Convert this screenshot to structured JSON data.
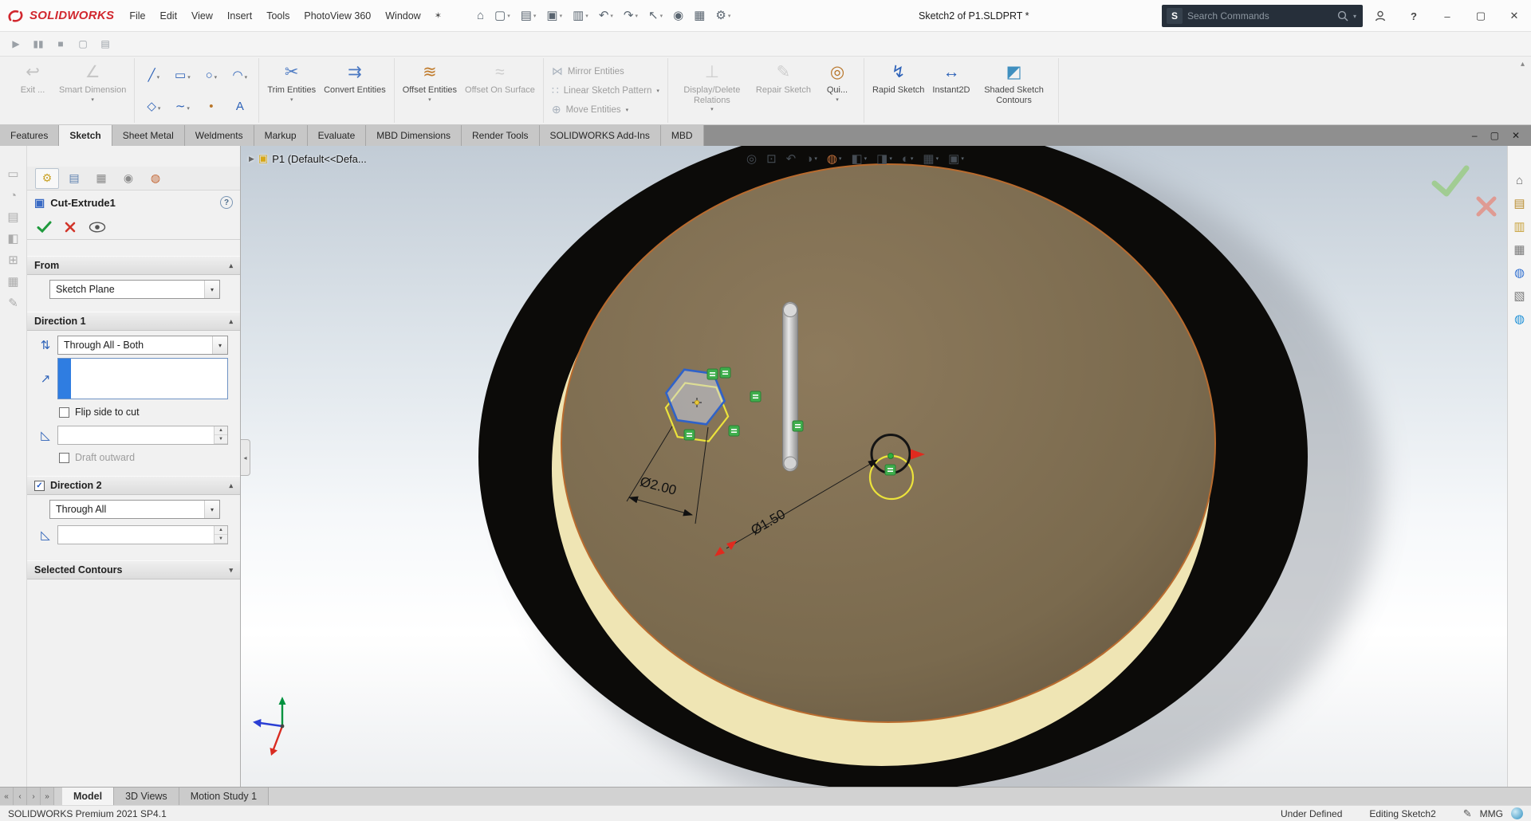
{
  "titlebar": {
    "logo_text": "SOLIDWORKS",
    "menus": [
      "File",
      "Edit",
      "View",
      "Insert",
      "Tools",
      "PhotoView 360",
      "Window"
    ],
    "title": "Sketch2 of P1.SLDPRT *",
    "search_placeholder": "Search Commands",
    "quick_access": [
      {
        "name": "view-home",
        "glyph": "⌂"
      },
      {
        "name": "new-document",
        "glyph": "▢",
        "caret": true
      },
      {
        "name": "open-document",
        "glyph": "▤",
        "caret": true
      },
      {
        "name": "save-document",
        "glyph": "▣",
        "caret": true
      },
      {
        "name": "print-document",
        "glyph": "▥",
        "caret": true
      },
      {
        "name": "undo",
        "glyph": "↶",
        "caret": true
      },
      {
        "name": "redo",
        "glyph": "↷",
        "caret": true
      },
      {
        "name": "select-tool",
        "glyph": "↖",
        "caret": true
      },
      {
        "name": "rebuild",
        "glyph": "◉"
      },
      {
        "name": "file-properties",
        "glyph": "▦"
      },
      {
        "name": "options",
        "glyph": "⚙",
        "caret": true
      }
    ]
  },
  "macro_toolbar": [
    {
      "name": "macro-run",
      "glyph": "▶"
    },
    {
      "name": "macro-pause",
      "glyph": "▮▮"
    },
    {
      "name": "macro-stop",
      "glyph": "■"
    },
    {
      "name": "macro-new",
      "glyph": "▢"
    },
    {
      "name": "macro-edit",
      "glyph": "▤"
    }
  ],
  "ribbon": {
    "g1": [
      {
        "name": "exit-sketch",
        "label": "Exit ...",
        "glyph": "↩",
        "color": "#7d8aa0",
        "disabled": true
      },
      {
        "name": "smart-dimension",
        "label": "Smart Dimension",
        "glyph": "∠",
        "color": "#8a96a8",
        "disabled": true,
        "caret": true
      }
    ],
    "sketch_tools": [
      {
        "name": "line-tool",
        "glyph": "╱",
        "color": "#2d62b8",
        "caret": true
      },
      {
        "name": "rectangle-tool",
        "glyph": "▭",
        "color": "#2d62b8",
        "caret": true
      },
      {
        "name": "circle-tool",
        "glyph": "○",
        "color": "#2d62b8",
        "caret": true
      },
      {
        "name": "arc-tool",
        "glyph": "◠",
        "color": "#2d62b8",
        "caret": true
      },
      {
        "name": "polygon-tool",
        "glyph": "◇",
        "color": "#2d62b8",
        "caret": true
      },
      {
        "name": "spline-tool",
        "glyph": "∼",
        "color": "#2d62b8",
        "caret": true
      },
      {
        "name": "point-tool",
        "glyph": "•",
        "color": "#b8762a"
      },
      {
        "name": "text-tool",
        "glyph": "A",
        "color": "#2d62b8"
      }
    ],
    "g3": [
      {
        "name": "trim-entities",
        "label": "Trim Entities",
        "glyph": "✂",
        "color": "#4a78c2",
        "caret": true
      },
      {
        "name": "convert-entities",
        "label": "Convert Entities",
        "glyph": "⇉",
        "color": "#4a78c2"
      }
    ],
    "g4": [
      {
        "name": "offset-entities",
        "label": "Offset Entities",
        "glyph": "≋",
        "color": "#c07a2a",
        "caret": true
      },
      {
        "name": "offset-on-surface",
        "label": "Offset On Surface",
        "glyph": "≈",
        "color": "#9aa4b2",
        "disabled": true
      }
    ],
    "g5": [
      {
        "name": "mirror-entities",
        "label": "Mirror Entities",
        "glyph": "⋈",
        "disabled": true
      },
      {
        "name": "linear-sketch-pattern",
        "label": "Linear Sketch Pattern",
        "glyph": "∷",
        "disabled": true,
        "caret": true
      },
      {
        "name": "move-entities",
        "label": "Move Entities",
        "glyph": "⊕",
        "disabled": true,
        "caret": true
      }
    ],
    "g6": [
      {
        "name": "display-delete-relations",
        "label": "Display/Delete Relations",
        "glyph": "⊥",
        "color": "#9aa4b2",
        "disabled": true,
        "caret": true
      },
      {
        "name": "repair-sketch",
        "label": "Repair Sketch",
        "glyph": "✎",
        "color": "#9aa4b2",
        "disabled": true
      },
      {
        "name": "quick-snaps",
        "label": "Qui...",
        "glyph": "◎",
        "color": "#b8762a",
        "caret": true
      }
    ],
    "g7": [
      {
        "name": "rapid-sketch",
        "label": "Rapid Sketch",
        "glyph": "↯",
        "color": "#2d62b8"
      },
      {
        "name": "instant2d",
        "label": "Instant2D",
        "glyph": "↔",
        "color": "#2d62b8",
        "active": true
      },
      {
        "name": "shaded-sketch-contours",
        "label": "Shaded Sketch Contours",
        "glyph": "◩",
        "color": "#3f8fbf"
      }
    ]
  },
  "command_tabs": [
    {
      "label": "Features"
    },
    {
      "label": "Sketch",
      "active": true
    },
    {
      "label": "Sheet Metal"
    },
    {
      "label": "Weldments"
    },
    {
      "label": "Markup"
    },
    {
      "label": "Evaluate"
    },
    {
      "label": "MBD Dimensions"
    },
    {
      "label": "Render Tools"
    },
    {
      "label": "SOLIDWORKS Add-Ins"
    },
    {
      "label": "MBD"
    }
  ],
  "left_toolbar": [
    {
      "name": "docked-tool-1",
      "glyph": "▭"
    },
    {
      "name": "docked-tool-2",
      "glyph": "◔"
    },
    {
      "name": "docked-tool-3",
      "glyph": "▤"
    },
    {
      "name": "docked-tool-4",
      "glyph": "◧"
    },
    {
      "name": "docked-tool-5",
      "glyph": "⊞"
    },
    {
      "name": "docked-tool-6",
      "glyph": "▦"
    },
    {
      "name": "docked-tool-7",
      "glyph": "✎"
    }
  ],
  "property_manager": {
    "tabs": [
      {
        "name": "propertymanager-tab",
        "glyph": "⚙",
        "color": "#c9a227",
        "active": true
      },
      {
        "name": "configuration-tab",
        "glyph": "▤",
        "color": "#5b7fae"
      },
      {
        "name": "dimxpert-tab",
        "glyph": "▦",
        "color": "#8a8a8a"
      },
      {
        "name": "display-pane-tab",
        "glyph": "◉",
        "color": "#8a8a8a"
      },
      {
        "name": "appearance-tab",
        "glyph": "◍",
        "color": "#c2622f"
      }
    ],
    "title": "Cut-Extrude1",
    "from": {
      "header": "From",
      "value": "Sketch Plane"
    },
    "direction1": {
      "header": "Direction 1",
      "value": "Through All - Both",
      "flip_label": "Flip side to cut",
      "draft_outward_label": "Draft outward"
    },
    "direction2": {
      "header": "Direction 2",
      "value": "Through All"
    },
    "contours": {
      "header": "Selected Contours"
    }
  },
  "viewport": {
    "tree_label": "P1 (Default<<Defa...",
    "dim_hexagon": "Ø2.00",
    "dim_circle": "Ø1.50",
    "headsup": [
      {
        "name": "zoom-to-fit",
        "glyph": "◎"
      },
      {
        "name": "zoom-to-area",
        "glyph": "⊡"
      },
      {
        "name": "previous-view",
        "glyph": "↶"
      },
      {
        "name": "section-view",
        "glyph": "◑",
        "caret": true
      },
      {
        "name": "appearances",
        "glyph": "◍",
        "caret": true,
        "color": "#c2703a"
      },
      {
        "name": "view-orientation",
        "glyph": "◧",
        "caret": true
      },
      {
        "name": "display-style",
        "glyph": "◨",
        "caret": true
      },
      {
        "name": "hide-show-items",
        "glyph": "◐",
        "caret": true
      },
      {
        "name": "scene",
        "glyph": "▦",
        "caret": true
      },
      {
        "name": "view-settings",
        "glyph": "▣",
        "caret": true
      }
    ]
  },
  "task_pane": [
    {
      "name": "task-home",
      "glyph": "⌂",
      "color": "#6b6b6b"
    },
    {
      "name": "task-solidworks-resources",
      "glyph": "▤",
      "color": "#b98c2f"
    },
    {
      "name": "task-design-library",
      "glyph": "▥",
      "color": "#c8a23c"
    },
    {
      "name": "task-file-explorer",
      "glyph": "▦",
      "color": "#7a7a7a"
    },
    {
      "name": "task-appearances",
      "glyph": "◍",
      "color": "#2f6fd0"
    },
    {
      "name": "task-custom-properties",
      "glyph": "▧",
      "color": "#7a7a7a"
    },
    {
      "name": "task-forum",
      "glyph": "◍",
      "color": "#1c8fd6"
    }
  ],
  "doc_tabs": {
    "nav": [
      {
        "name": "scroll-first",
        "glyph": "«"
      },
      {
        "name": "scroll-prev",
        "glyph": "‹"
      },
      {
        "name": "scroll-next",
        "glyph": "›"
      },
      {
        "name": "scroll-last",
        "glyph": "»"
      }
    ],
    "tabs": [
      {
        "label": "Model",
        "active": true
      },
      {
        "label": "3D Views"
      },
      {
        "label": "Motion Study 1"
      }
    ]
  },
  "statusbar": {
    "left": "SOLIDWORKS Premium 2021 SP4.1",
    "state": "Under Defined",
    "mode": "Editing Sketch2",
    "user": "MMG"
  }
}
